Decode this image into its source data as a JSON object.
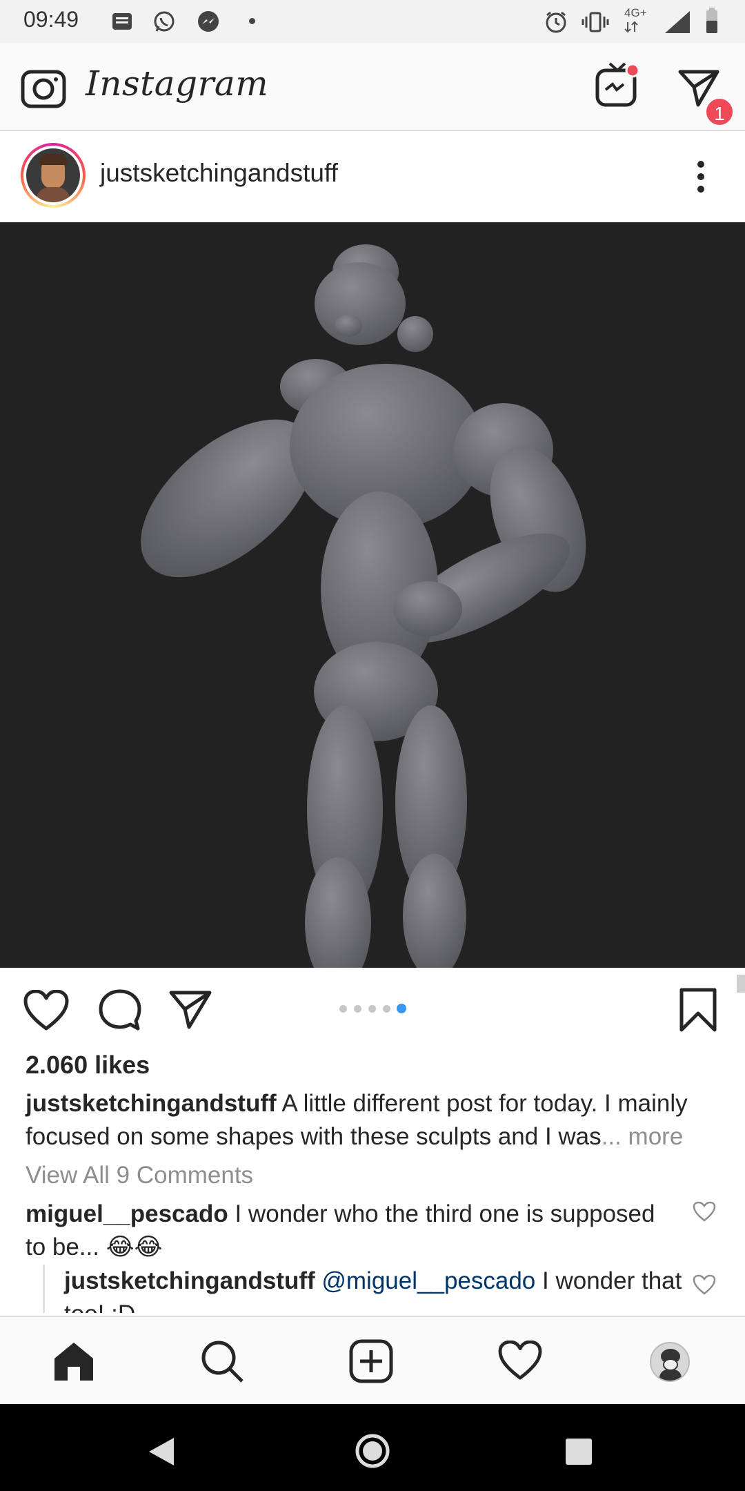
{
  "status_bar": {
    "time": "09:49",
    "network": "4G+",
    "icons": [
      "news-icon",
      "whatsapp-icon",
      "messenger-icon",
      "alarm-icon",
      "vibrate-icon",
      "signal-icon",
      "battery-icon"
    ]
  },
  "app": {
    "title": "Instagram",
    "dm_badge_count": "1"
  },
  "post": {
    "username": "justsketchingandstuff",
    "carousel": {
      "count": 5,
      "active_index": 4
    },
    "likes": "2.060 likes",
    "caption_user": "justsketchingandstuff",
    "caption_text": "A little different post for today. I mainly focused on some shapes with these sculpts and I was",
    "caption_more": "... more",
    "view_comments": "View All 9 Comments",
    "comments": [
      {
        "user": "miguel__pescado",
        "text": "I wonder who the third one is supposed to be... 😂😂"
      },
      {
        "user": "justsketchingandstuff",
        "mention": "@miguel__pescado",
        "text": "I wonder that too! :D"
      }
    ]
  },
  "colors": {
    "accent_blue": "#3897f0",
    "badge_red": "#ed4956",
    "image_bg": "#222222"
  }
}
